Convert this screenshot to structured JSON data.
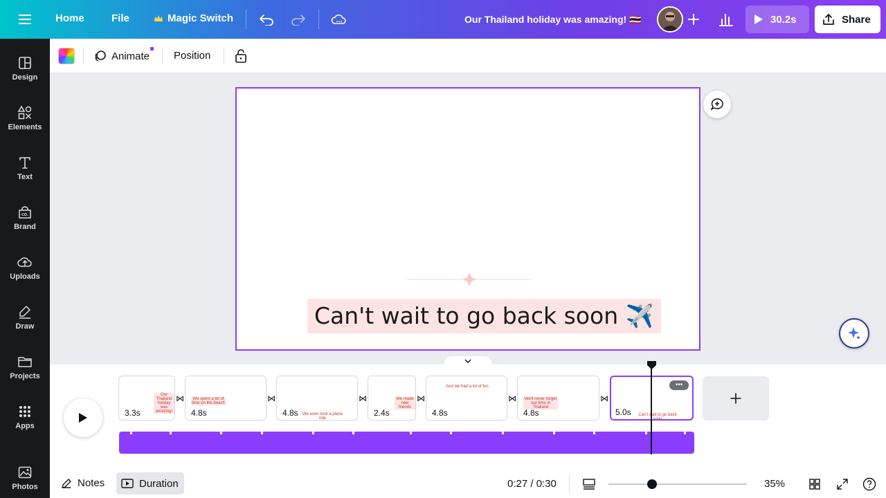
{
  "topbar": {
    "home_label": "Home",
    "file_label": "File",
    "magic_switch_label": "Magic Switch",
    "document_title": "Our Thailand holiday was amazing! 🇹🇭",
    "play_duration": "30.2s",
    "share_label": "Share"
  },
  "sidebar": {
    "items": [
      {
        "label": "Design",
        "icon": "design-icon"
      },
      {
        "label": "Elements",
        "icon": "elements-icon"
      },
      {
        "label": "Text",
        "icon": "text-icon"
      },
      {
        "label": "Brand",
        "icon": "brand-icon"
      },
      {
        "label": "Uploads",
        "icon": "uploads-icon"
      },
      {
        "label": "Draw",
        "icon": "draw-icon"
      },
      {
        "label": "Projects",
        "icon": "projects-icon"
      },
      {
        "label": "Apps",
        "icon": "apps-icon"
      },
      {
        "label": "Photos",
        "icon": "photos-icon"
      }
    ]
  },
  "toolbar": {
    "animate_label": "Animate",
    "position_label": "Position"
  },
  "canvas": {
    "caption": "Can't wait to go back soon ✈️"
  },
  "timeline": {
    "clips": [
      {
        "duration": "3.3s",
        "thumb": "Our Thailand holiday was amazing!"
      },
      {
        "duration": "4.8s",
        "thumb": "We spent a lot of time on the beach"
      },
      {
        "duration": "4.8s",
        "thumb": "We even took a plane ride"
      },
      {
        "duration": "2.4s",
        "thumb": "We made new friends"
      },
      {
        "duration": "4.8s",
        "thumb": "And we had a lot of fun"
      },
      {
        "duration": "4.8s",
        "thumb": "We'll never forget our time in Thailand"
      },
      {
        "duration": "5.0s",
        "thumb": "Can't wait to go back soon"
      }
    ],
    "time_display": "0:27 / 0:30",
    "zoom": "35%"
  },
  "bottombar": {
    "notes_label": "Notes",
    "duration_label": "Duration"
  },
  "colors": {
    "accent": "#8b3dff",
    "sidebar_bg": "#18191b",
    "caption_bg": "#fde4e4"
  }
}
